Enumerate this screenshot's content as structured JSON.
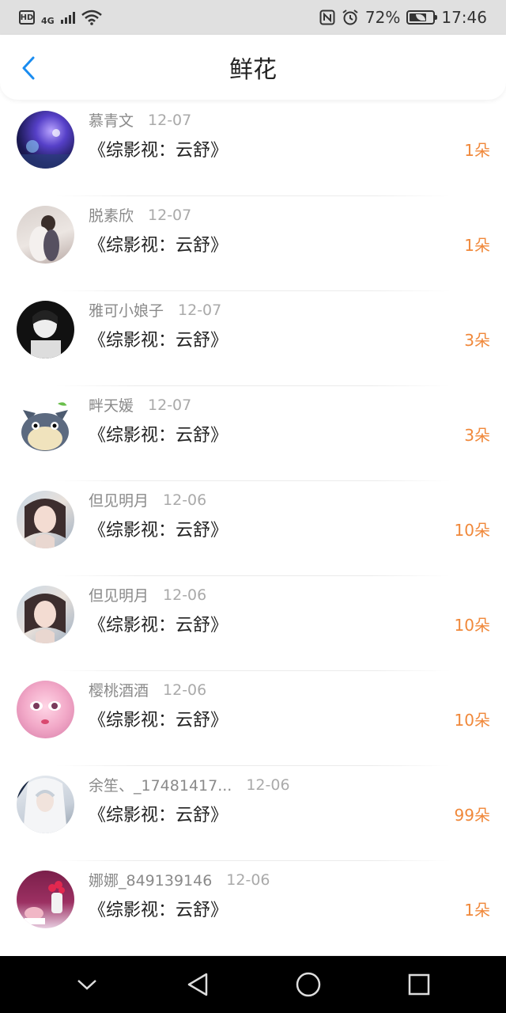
{
  "status_bar": {
    "hd": "HD",
    "network": "4G",
    "battery_percent": "72%",
    "time": "17:46",
    "battery_level": 0.72
  },
  "header": {
    "title": "鲜花",
    "back_icon": "chevron-left-icon",
    "accent_color": "#1a8cf0"
  },
  "flower_list": [
    {
      "username": "慕青文",
      "date": "12-07",
      "book": "《综影视：云舒》",
      "amount": "1朵"
    },
    {
      "username": "脱素欣",
      "date": "12-07",
      "book": "《综影视：云舒》",
      "amount": "1朵"
    },
    {
      "username": "雅可小娘子",
      "date": "12-07",
      "book": "《综影视：云舒》",
      "amount": "3朵"
    },
    {
      "username": "畔天媛",
      "date": "12-07",
      "book": "《综影视：云舒》",
      "amount": "3朵"
    },
    {
      "username": "但见明月",
      "date": "12-06",
      "book": "《综影视：云舒》",
      "amount": "10朵"
    },
    {
      "username": "但见明月",
      "date": "12-06",
      "book": "《综影视：云舒》",
      "amount": "10朵"
    },
    {
      "username": "樱桃酒酒",
      "date": "12-06",
      "book": "《综影视：云舒》",
      "amount": "10朵"
    },
    {
      "username": "余笙、_17481417...",
      "date": "12-06",
      "book": "《综影视：云舒》",
      "amount": "99朵"
    },
    {
      "username": "娜娜_849139146",
      "date": "12-06",
      "book": "《综影视：云舒》",
      "amount": "1朵"
    }
  ],
  "colors": {
    "amount": "#f0883a",
    "username": "#8a8a8a",
    "date": "#aaaaaa",
    "status_bar_bg": "#e0e0e0",
    "nav_bar_bg": "#000000"
  },
  "nav_bar": {
    "icons": [
      "chevron-down-icon",
      "back-triangle-icon",
      "home-circle-icon",
      "recents-square-icon"
    ]
  }
}
